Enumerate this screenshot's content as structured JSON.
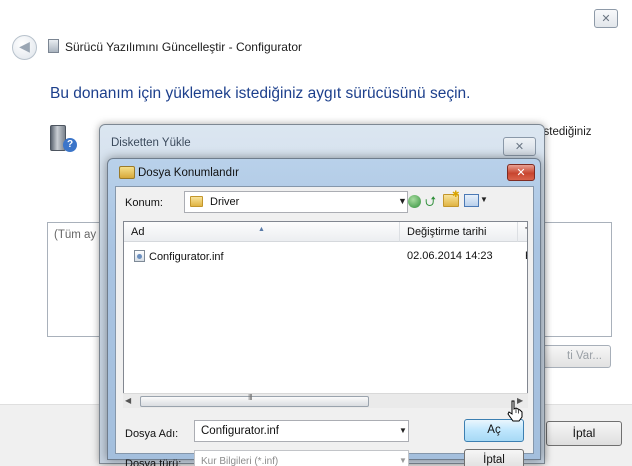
{
  "wizard": {
    "close_glyph": "✕",
    "title": "Sürücü Yazılımını Güncelleştir - Configurator",
    "heading": "Bu donanım için yüklemek istediğiniz aygıt sürücüsünü seçin.",
    "partial_text": "istediğiniz",
    "list_item_partial": "(Tüm ay",
    "have_disk_partial": "ti Var...",
    "cancel_label": "İptal"
  },
  "disk_dialog": {
    "title": "Disketten Yükle",
    "close_glyph": "✕"
  },
  "browse_dialog": {
    "title": "Dosya Konumlandır",
    "close_glyph": "✕",
    "location_label": "Konum:",
    "location_value": "Driver",
    "columns": {
      "name": "Ad",
      "date": "Değiştirme tarihi",
      "type": "Tü"
    },
    "files": [
      {
        "name": "Configurator.inf",
        "date": "02.06.2014 14:23",
        "type": "Ku"
      }
    ],
    "scroll_grip": "III",
    "filename_label": "Dosya Adı:",
    "filename_value": "Configurator.inf",
    "filetype_label": "Dosya türü:",
    "filetype_value": "Kur Bilgileri (*.inf)",
    "open_label": "Aç",
    "cancel_label": "İptal"
  },
  "icons": {
    "back": "◀",
    "dropdown": "▼",
    "up": "⮍",
    "scroll_left": "◀",
    "scroll_right": "▶",
    "sort": "▲"
  },
  "colors": {
    "heading_blue": "#1c3f8c",
    "dialog_frame": "#a9c4e2",
    "close_red": "#c8452f",
    "default_button": "#bee6fd"
  }
}
